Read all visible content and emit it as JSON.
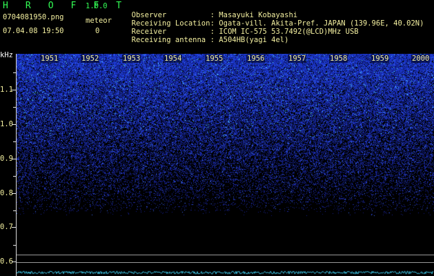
{
  "app": {
    "title": "H R O F F T",
    "version": "1.0.0"
  },
  "file": {
    "name": "0704081950.png",
    "datetime": "07.04.08 19:50"
  },
  "meteor": {
    "label": "meteor",
    "count": "0"
  },
  "info": {
    "observer_label": "Observer",
    "observer_value": ": Masayuki Kobayashi",
    "location_label": "Receiving Location",
    "location_value": ": Ogata-vill. Akita-Pref. JAPAN (139.96E, 40.02N)",
    "receiver_label": "Receiver",
    "receiver_value": ": ICOM IC-575 53.7492(@LCD)MHz USB",
    "antenna_label": "Receiving antenna",
    "antenna_value": ": A504HB(yagi 4el)"
  },
  "yaxis": {
    "unit": "kHz",
    "labels": [
      "1.1",
      "1.0",
      "0.9",
      "0.8",
      "0.7",
      "0.6"
    ]
  },
  "xaxis": {
    "seconds": [
      "1951",
      "1952",
      "1953",
      "1954",
      "1955",
      "1956",
      "1957",
      "1958",
      "1959",
      "2000"
    ]
  },
  "colors": {
    "background": "#000000",
    "text": "#f4f0a0",
    "accent_green": "#33ff55",
    "noise_blue": "#2a4cff",
    "noise_cyan": "#5ff0ff"
  }
}
